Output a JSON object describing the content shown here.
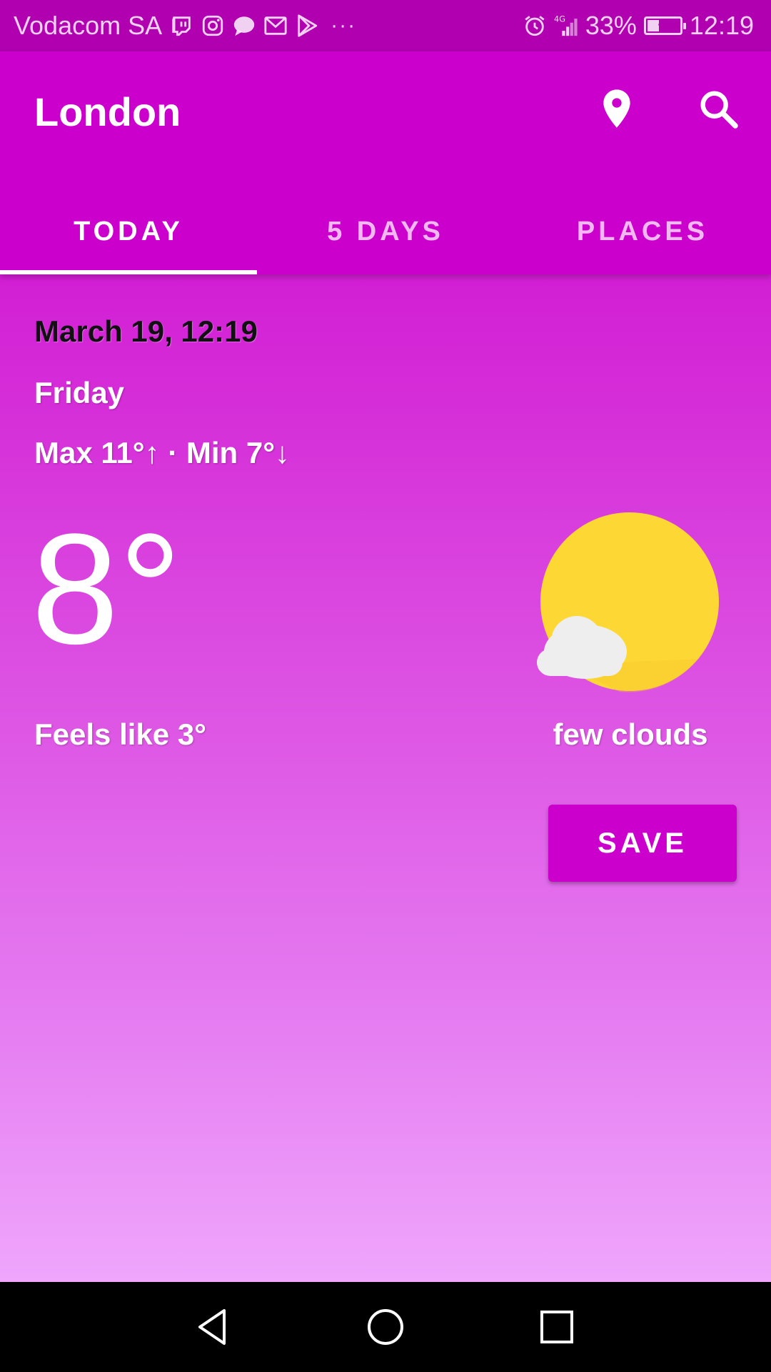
{
  "status_bar": {
    "carrier": "Vodacom SA",
    "notification_icons": [
      "twitch-icon",
      "instagram-icon",
      "messaging-icon",
      "gmail-icon",
      "play-store-icon"
    ],
    "more": "···",
    "network": "4G",
    "battery_percent_label": "33%",
    "battery_level": 0.33,
    "time": "12:19"
  },
  "app_bar": {
    "title": "London",
    "actions": [
      "location-icon",
      "search-icon"
    ]
  },
  "tabs": [
    {
      "label": "TODAY",
      "selected": true
    },
    {
      "label": "5 DAYS",
      "selected": false
    },
    {
      "label": "PLACES",
      "selected": false
    }
  ],
  "weather": {
    "date_time": "March 19, 12:19",
    "day": "Friday",
    "range": "Max 11°↑ · Min 7°↓",
    "temperature": "8°",
    "feels_like": "Feels like 3°",
    "condition": "few clouds",
    "condition_icon": "sun-with-cloud-icon"
  },
  "save_button": {
    "label": "SAVE"
  },
  "colors": {
    "primary": "#cc00cc",
    "status_bar": "#b000b0",
    "sun": "#fdd835",
    "cloud": "#eeeeee"
  },
  "nav_bar": [
    "back-icon",
    "home-icon",
    "recents-icon"
  ]
}
